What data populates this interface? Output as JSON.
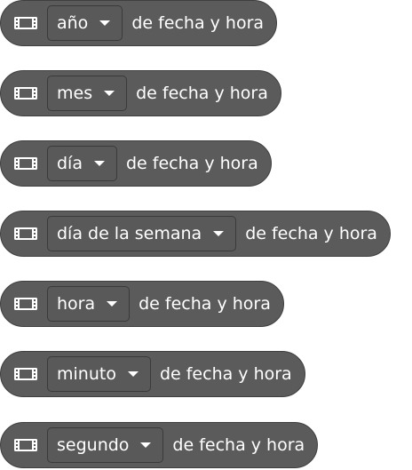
{
  "blocks": [
    {
      "option": "año",
      "suffix": "de fecha y hora"
    },
    {
      "option": "mes",
      "suffix": "de fecha y hora"
    },
    {
      "option": "día",
      "suffix": "de fecha y hora"
    },
    {
      "option": "día de la semana",
      "suffix": "de fecha y hora"
    },
    {
      "option": "hora",
      "suffix": "de fecha y hora"
    },
    {
      "option": "minuto",
      "suffix": "de fecha y hora"
    },
    {
      "option": "segundo",
      "suffix": "de fecha y hora"
    }
  ],
  "icon": "film-strip-icon",
  "colors": {
    "block_fill": "#5b5b5b",
    "block_border": "#3f3f3f",
    "text": "#ffffff"
  }
}
